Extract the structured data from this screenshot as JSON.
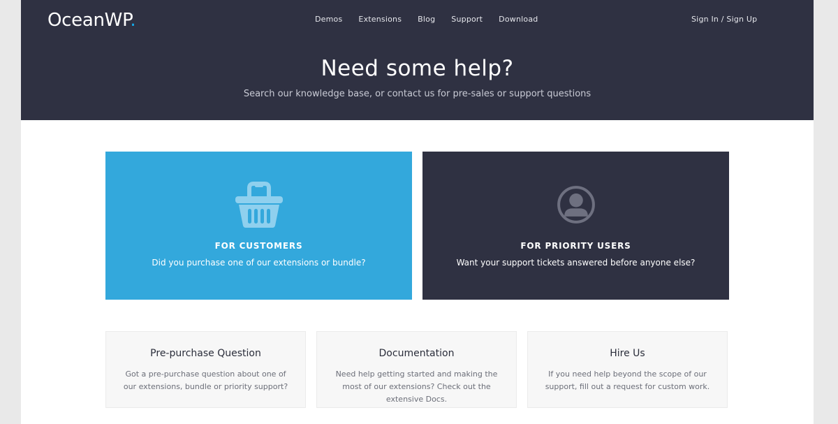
{
  "header": {
    "logo_text": "OceanWP",
    "logo_dot": ".",
    "nav": [
      "Demos",
      "Extensions",
      "Blog",
      "Support",
      "Download"
    ],
    "signin": "Sign In / Sign Up",
    "colors": {
      "background": "#2f3142",
      "accent": "#13aff0"
    }
  },
  "hero": {
    "title": "Need some help?",
    "subtitle": "Search our knowledge base, or contact us for pre-sales or support questions"
  },
  "cards": [
    {
      "icon": "basket-icon",
      "title": "FOR CUSTOMERS",
      "desc": "Did you purchase one of our extensions or bundle?",
      "color": "#33a8dc"
    },
    {
      "icon": "user-circle-icon",
      "title": "FOR PRIORITY USERS",
      "desc": "Want your support tickets answered before anyone else?",
      "color": "#2f3142"
    }
  ],
  "help_boxes": [
    {
      "title": "Pre-purchase Question",
      "desc": "Got a pre-purchase question about one of our extensions, bundle or priority support?"
    },
    {
      "title": "Documentation",
      "desc": "Need help getting started and making the most of our extensions? Check out the extensive Docs."
    },
    {
      "title": "Hire Us",
      "desc": "If you need help beyond the scope of our support, fill out a request for custom work."
    }
  ]
}
